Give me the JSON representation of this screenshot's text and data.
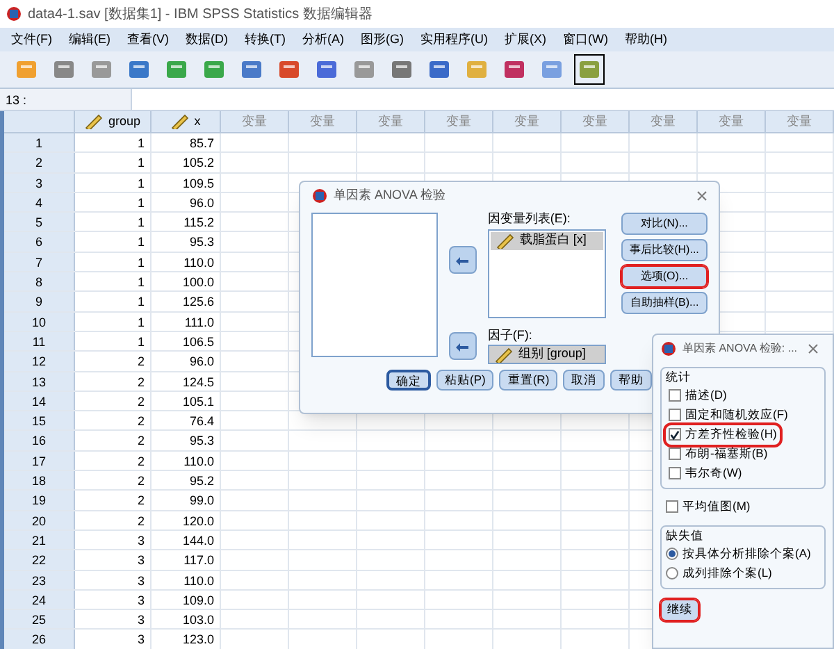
{
  "window": {
    "title": "data4-1.sav [数据集1] - IBM SPSS Statistics 数据编辑器"
  },
  "menu": [
    "文件(F)",
    "编辑(E)",
    "查看(V)",
    "数据(D)",
    "转换(T)",
    "分析(A)",
    "图形(G)",
    "实用程序(U)",
    "扩展(X)",
    "窗口(W)",
    "帮助(H)"
  ],
  "cell_ref": "13 :",
  "table": {
    "columns": [
      {
        "name": "group",
        "kind": "variable"
      },
      {
        "name": "x",
        "kind": "variable"
      },
      {
        "name": "变量",
        "kind": "empty"
      },
      {
        "name": "变量",
        "kind": "empty"
      },
      {
        "name": "变量",
        "kind": "empty"
      },
      {
        "name": "变量",
        "kind": "empty"
      },
      {
        "name": "变量",
        "kind": "empty"
      },
      {
        "name": "变量",
        "kind": "empty"
      },
      {
        "name": "变量",
        "kind": "empty"
      },
      {
        "name": "变量",
        "kind": "empty"
      },
      {
        "name": "变量",
        "kind": "empty"
      }
    ],
    "rows": [
      {
        "number": "1",
        "cells": [
          "1",
          "85.7"
        ]
      },
      {
        "number": "2",
        "cells": [
          "1",
          "105.2"
        ]
      },
      {
        "number": "3",
        "cells": [
          "1",
          "109.5"
        ]
      },
      {
        "number": "4",
        "cells": [
          "1",
          "96.0"
        ]
      },
      {
        "number": "5",
        "cells": [
          "1",
          "115.2"
        ]
      },
      {
        "number": "6",
        "cells": [
          "1",
          "95.3"
        ]
      },
      {
        "number": "7",
        "cells": [
          "1",
          "110.0"
        ]
      },
      {
        "number": "8",
        "cells": [
          "1",
          "100.0"
        ]
      },
      {
        "number": "9",
        "cells": [
          "1",
          "125.6"
        ]
      },
      {
        "number": "10",
        "cells": [
          "1",
          "111.0"
        ]
      },
      {
        "number": "11",
        "cells": [
          "1",
          "106.5"
        ]
      },
      {
        "number": "12",
        "cells": [
          "2",
          "96.0"
        ]
      },
      {
        "number": "13",
        "cells": [
          "2",
          "124.5"
        ]
      },
      {
        "number": "14",
        "cells": [
          "2",
          "105.1"
        ]
      },
      {
        "number": "15",
        "cells": [
          "2",
          "76.4"
        ]
      },
      {
        "number": "16",
        "cells": [
          "2",
          "95.3"
        ]
      },
      {
        "number": "17",
        "cells": [
          "2",
          "110.0"
        ]
      },
      {
        "number": "18",
        "cells": [
          "2",
          "95.2"
        ]
      },
      {
        "number": "19",
        "cells": [
          "2",
          "99.0"
        ]
      },
      {
        "number": "20",
        "cells": [
          "2",
          "120.0"
        ]
      },
      {
        "number": "21",
        "cells": [
          "3",
          "144.0"
        ]
      },
      {
        "number": "22",
        "cells": [
          "3",
          "117.0"
        ]
      },
      {
        "number": "23",
        "cells": [
          "3",
          "110.0"
        ]
      },
      {
        "number": "24",
        "cells": [
          "3",
          "109.0"
        ]
      },
      {
        "number": "25",
        "cells": [
          "3",
          "103.0"
        ]
      },
      {
        "number": "26",
        "cells": [
          "3",
          "123.0"
        ]
      }
    ]
  },
  "anova_dialog": {
    "title": "单因素 ANOVA 检验",
    "dependent_label": "因变量列表(E):",
    "dependent_items": [
      "载脂蛋白 [x]"
    ],
    "factor_label": "因子(F):",
    "factor_item": "组别 [group]",
    "side_buttons": [
      {
        "label": "对比(N)...",
        "highlighted": false
      },
      {
        "label": "事后比较(H)...",
        "highlighted": false
      },
      {
        "label": "选项(O)...",
        "highlighted": true
      },
      {
        "label": "自助抽样(B)...",
        "highlighted": false
      }
    ],
    "bottom_buttons": [
      {
        "label": "确定",
        "default": true
      },
      {
        "label": "粘贴(P)",
        "default": false
      },
      {
        "label": "重置(R)",
        "default": false
      },
      {
        "label": "取消",
        "default": false
      },
      {
        "label": "帮助",
        "default": false
      }
    ]
  },
  "options_dialog": {
    "title": "单因素 ANOVA 检验: ...",
    "statistics_label": "统计",
    "statistics": [
      {
        "label": "描述(D)",
        "checked": false,
        "highlighted": false
      },
      {
        "label": "固定和随机效应(F)",
        "checked": false,
        "highlighted": false
      },
      {
        "label": "方差齐性检验(H)",
        "checked": true,
        "highlighted": true
      },
      {
        "label": "布朗-福塞斯(B)",
        "checked": false,
        "highlighted": false
      },
      {
        "label": "韦尔奇(W)",
        "checked": false,
        "highlighted": false
      }
    ],
    "means_plot": {
      "label": "平均值图(M)",
      "checked": false
    },
    "missing_label": "缺失值",
    "missing": [
      {
        "label": "按具体分析排除个案(A)",
        "selected": true
      },
      {
        "label": "成列排除个案(L)",
        "selected": false
      }
    ],
    "continue_button": {
      "label": "继续",
      "highlighted": true
    }
  }
}
